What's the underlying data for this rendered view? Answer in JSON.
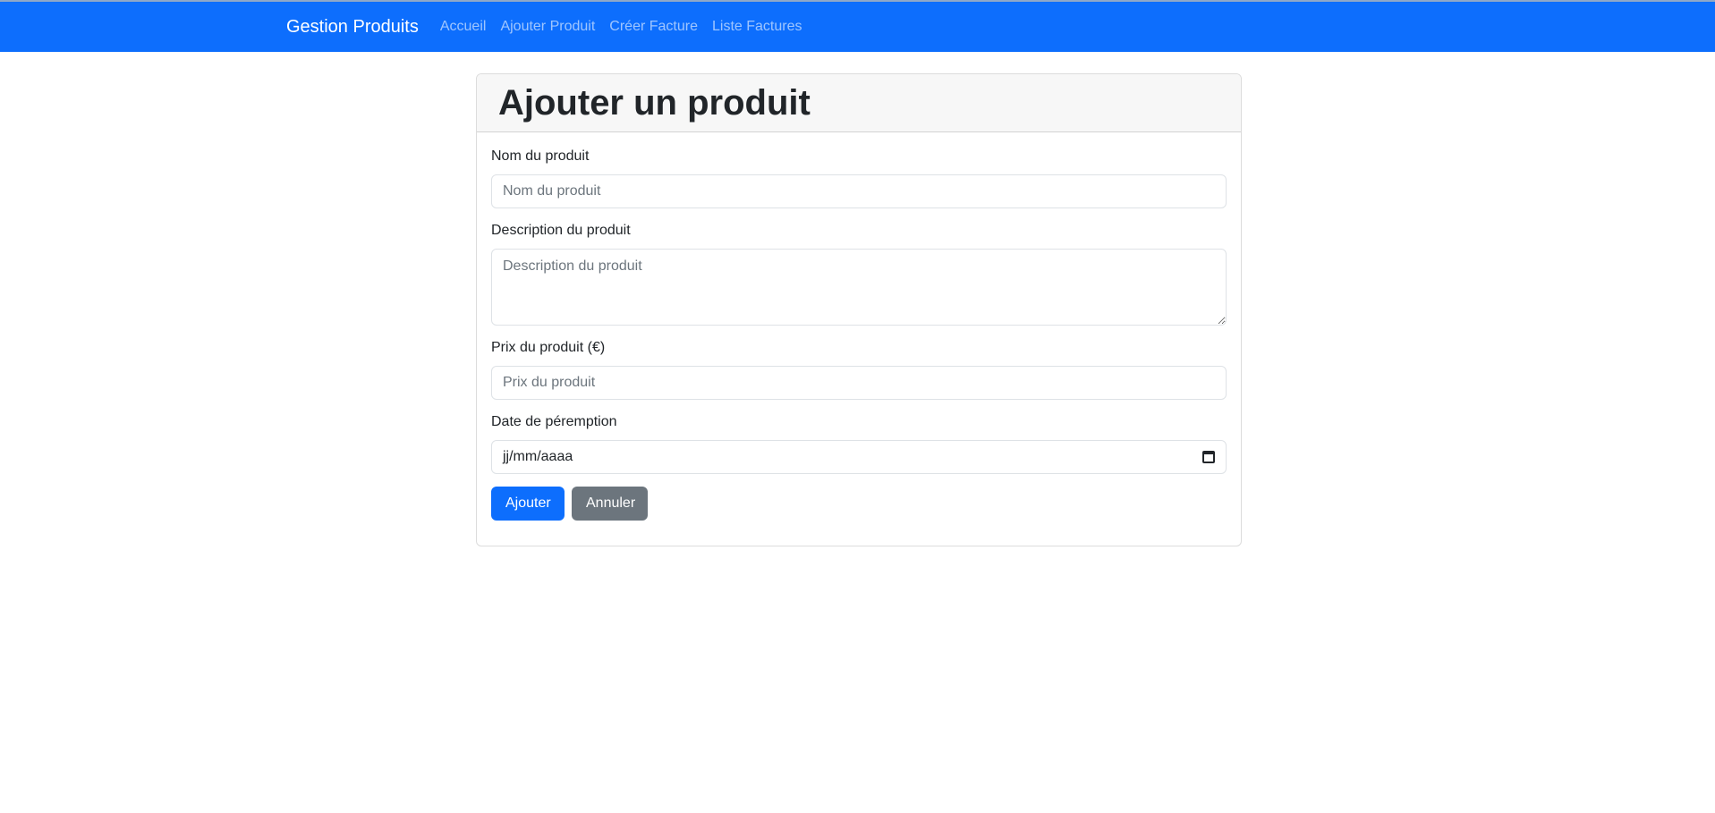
{
  "navbar": {
    "brand": "Gestion Produits",
    "links": [
      "Accueil",
      "Ajouter Produit",
      "Créer Facture",
      "Liste Factures"
    ]
  },
  "card": {
    "title": "Ajouter un produit"
  },
  "form": {
    "name_label": "Nom du produit",
    "name_placeholder": "Nom du produit",
    "description_label": "Description du produit",
    "description_placeholder": "Description du produit",
    "price_label": "Prix du produit (€)",
    "price_placeholder": "Prix du produit",
    "date_label": "Date de péremption",
    "date_placeholder": "jj/mm/aaaa",
    "submit_label": "Ajouter",
    "cancel_label": "Annuler"
  },
  "colors": {
    "primary": "#0d6efd",
    "secondary": "#6c757d"
  }
}
